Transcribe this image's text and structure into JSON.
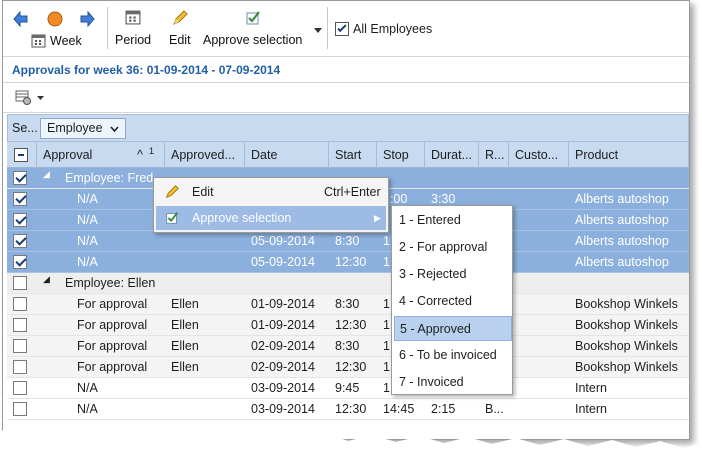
{
  "toolbar": {
    "week_label": "Week",
    "period_label": "Period",
    "edit_label": "Edit",
    "approve_label": "Approve selection",
    "all_employees_label": "All Employees",
    "all_employees_checked": true
  },
  "page": {
    "title": "Approvals for week 36: 01-09-2014 - 07-09-2014"
  },
  "group_panel": {
    "sel_label": "Se...",
    "group_chip": "Employee"
  },
  "columns": {
    "approval": "Approval",
    "approval_sort_index": "1",
    "approved_by": "Approved...",
    "date": "Date",
    "start": "Start",
    "stop": "Stop",
    "duration": "Durat...",
    "r": "R...",
    "customer": "Custo...",
    "product": "Product"
  },
  "groups": [
    {
      "label": "Employee: Fred"
    },
    {
      "label": "Employee: Ellen"
    }
  ],
  "rows_fred": [
    {
      "approval": "N/A",
      "approved_by": "",
      "date": "",
      "start": "",
      "stop": "2:00",
      "duration": "3:30",
      "r": "",
      "customer": "",
      "product": "Alberts autoshop"
    },
    {
      "approval": "N/A",
      "approved_by": "",
      "date": "",
      "start": "",
      "stop": "",
      "duration": "",
      "r": "",
      "customer": "",
      "product": "Alberts autoshop"
    },
    {
      "approval": "N/A",
      "approved_by": "",
      "date": "05-09-2014",
      "start": "8:30",
      "stop": "1",
      "duration": "",
      "r": "",
      "customer": "",
      "product": "Alberts autoshop"
    },
    {
      "approval": "N/A",
      "approved_by": "",
      "date": "05-09-2014",
      "start": "12:30",
      "stop": "1",
      "duration": "",
      "r": "",
      "customer": "",
      "product": "Alberts autoshop"
    }
  ],
  "rows_ellen": [
    {
      "approval": "For approval",
      "approved_by": "Ellen",
      "date": "01-09-2014",
      "start": "8:30",
      "stop": "1",
      "duration": "",
      "r": "",
      "customer": "",
      "product": "Bookshop Winkels"
    },
    {
      "approval": "For approval",
      "approved_by": "Ellen",
      "date": "01-09-2014",
      "start": "12:30",
      "stop": "1",
      "duration": "",
      "r": "",
      "customer": "",
      "product": "Bookshop Winkels"
    },
    {
      "approval": "For approval",
      "approved_by": "Ellen",
      "date": "02-09-2014",
      "start": "8:30",
      "stop": "1",
      "duration": "",
      "r": "",
      "customer": "",
      "product": "Bookshop Winkels"
    },
    {
      "approval": "For approval",
      "approved_by": "Ellen",
      "date": "02-09-2014",
      "start": "12:30",
      "stop": "1",
      "duration": "",
      "r": "",
      "customer": "",
      "product": "Bookshop Winkels"
    },
    {
      "approval": "N/A",
      "approved_by": "",
      "date": "03-09-2014",
      "start": "9:45",
      "stop": "1",
      "duration": "",
      "r": "",
      "customer": "",
      "product": "Intern"
    },
    {
      "approval": "N/A",
      "approved_by": "",
      "date": "03-09-2014",
      "start": "12:30",
      "stop": "14:45",
      "duration": "2:15",
      "r": "B...",
      "customer": "",
      "product": "Intern"
    }
  ],
  "context_menu": {
    "edit_label": "Edit",
    "edit_shortcut": "Ctrl+Enter",
    "approve_label": "Approve selection"
  },
  "submenu": [
    "1 - Entered",
    "2 - For approval",
    "3 - Rejected",
    "4 - Corrected",
    "5 - Approved",
    "6 - To be invoiced",
    "7 - Invoiced"
  ],
  "colors": {
    "accent": "#1f5fa8",
    "selection": "#8cb0dd",
    "header": "#c7daf0"
  }
}
